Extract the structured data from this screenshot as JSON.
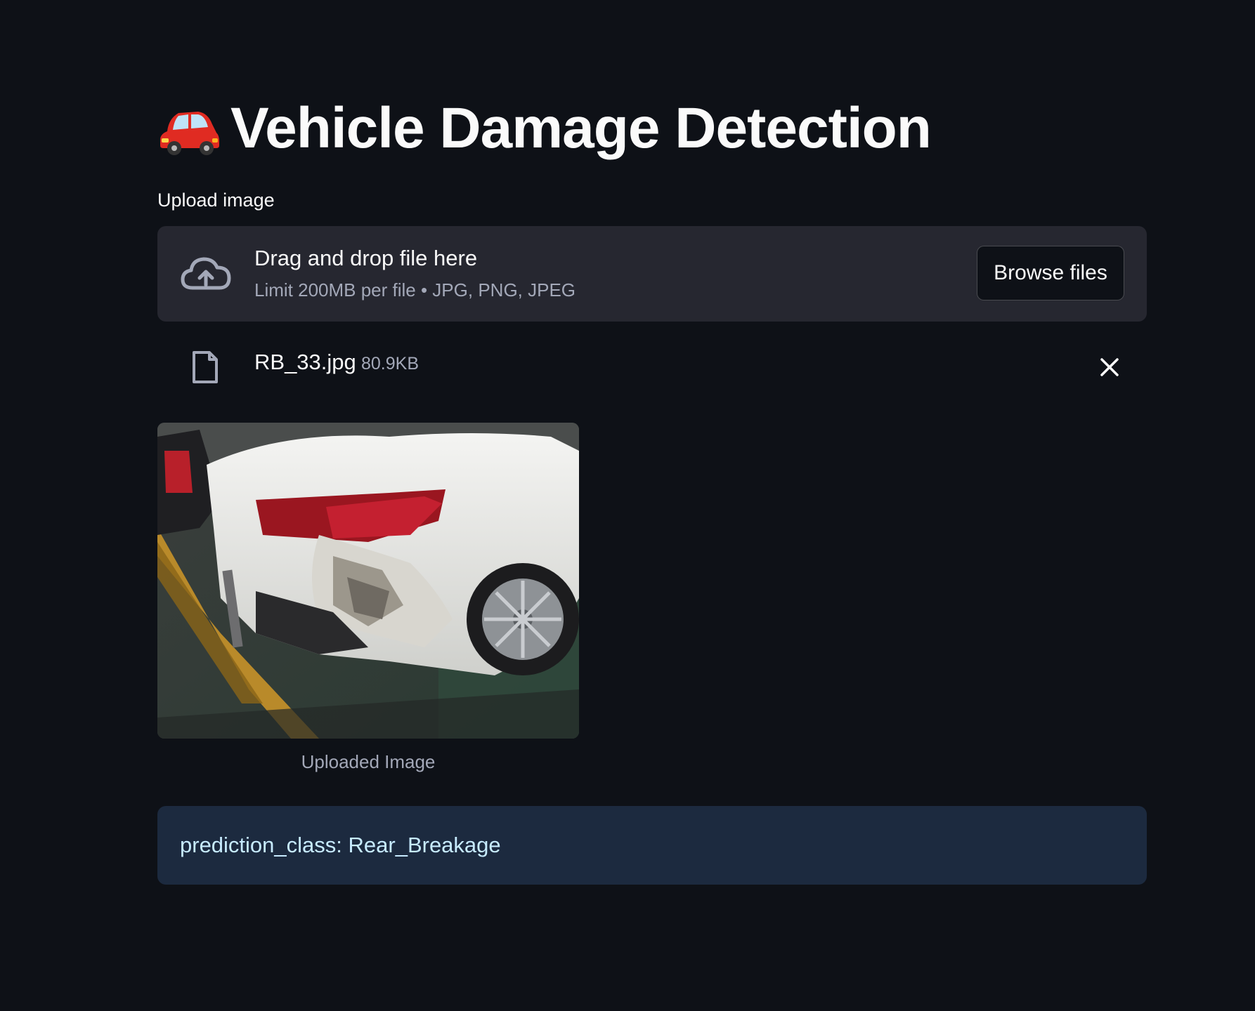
{
  "header": {
    "title_icon": "car-emoji",
    "title": "Vehicle Damage Detection"
  },
  "uploader": {
    "label": "Upload image",
    "icon": "cloud-upload-icon",
    "drag_text": "Drag and drop file here",
    "limit_text": "Limit 200MB per file • JPG, PNG, JPEG",
    "browse_label": "Browse files"
  },
  "uploaded_file": {
    "icon": "file-icon",
    "name": "RB_33.jpg",
    "size": "80.9KB",
    "remove_icon": "close-icon"
  },
  "image": {
    "caption": "Uploaded Image"
  },
  "result": {
    "text": "prediction_class: Rear_Breakage"
  },
  "colors": {
    "background": "#0e1117",
    "dropzone": "#262730",
    "result_box": "#1c2a3f",
    "result_text": "#c7ebff",
    "secondary_text": "#a3a8b8"
  }
}
